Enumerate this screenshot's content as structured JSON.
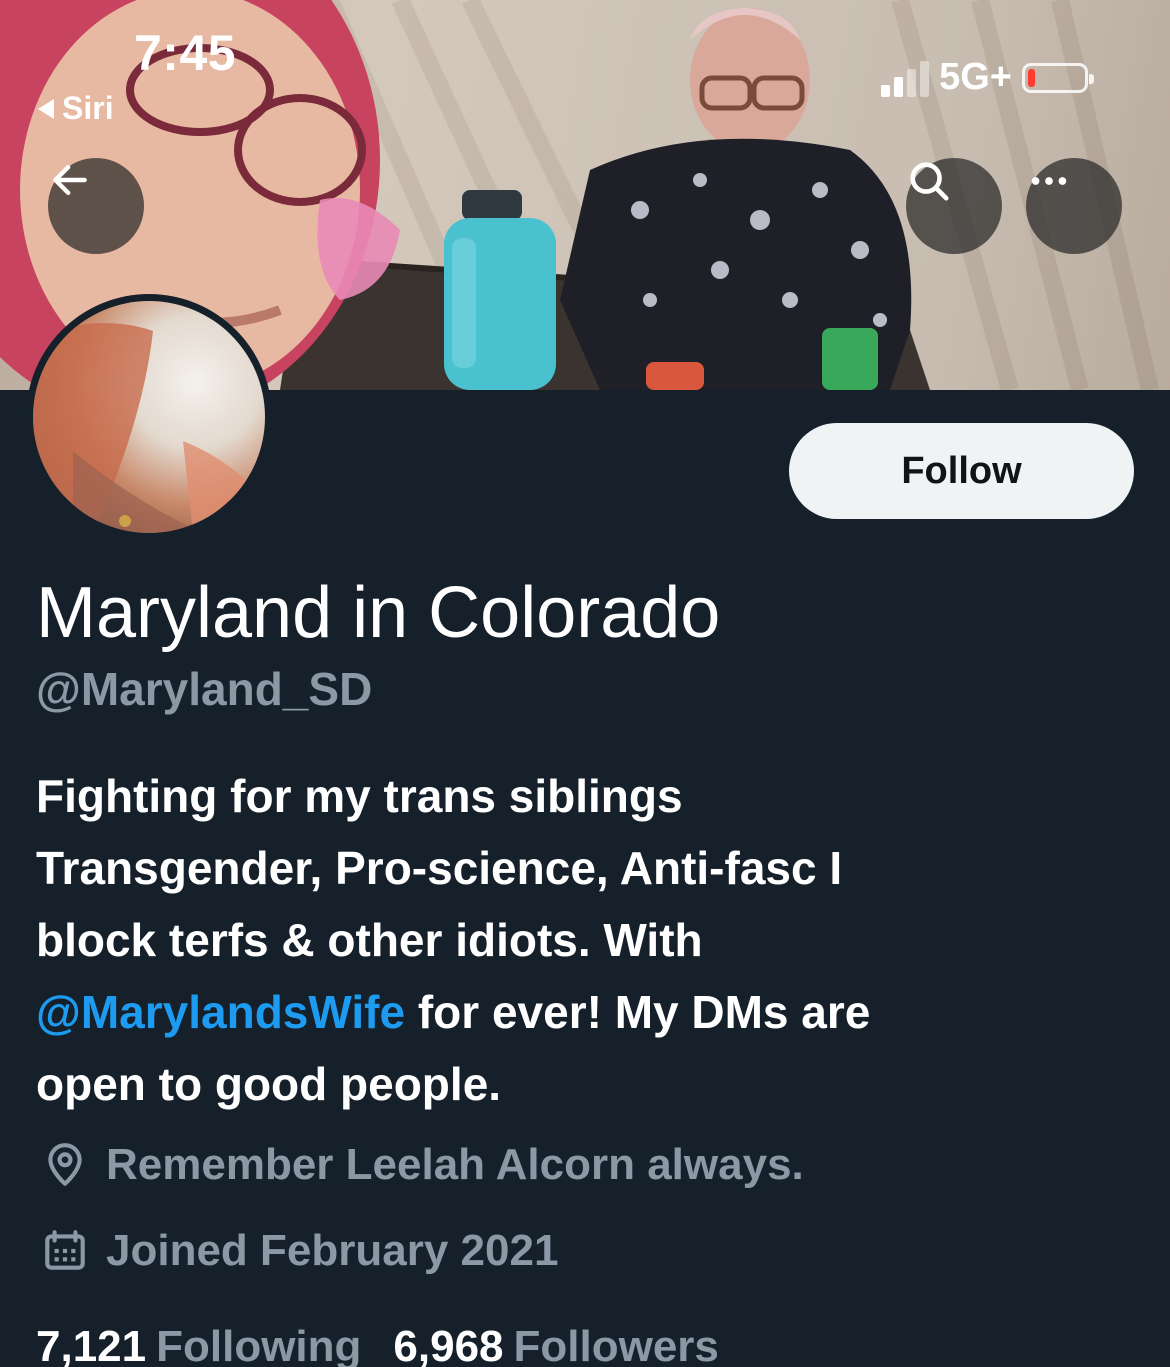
{
  "status_bar": {
    "time": "7:45",
    "back_app": "Siri",
    "network": "5G+",
    "battery_level_fraction": 0.08,
    "signal_bars_active": 2,
    "signal_bars_total": 4
  },
  "nav": {
    "back_icon": "arrow-left-icon",
    "search_icon": "search-icon",
    "more_icon": "more-horizontal-icon"
  },
  "profile": {
    "follow_label": "Follow",
    "display_name": "Maryland in Colorado",
    "handle": "@Maryland_SD",
    "bio": {
      "line1": "Fighting for my trans siblings",
      "line2": "Transgender, Pro-science, Anti-fasc I",
      "line3": "block terfs & other idiots. With",
      "mention": "@MarylandsWife",
      "line4_rest": " for ever! My DMs are",
      "line5": "open to good people."
    },
    "location": "Remember Leelah Alcorn always.",
    "joined": "Joined February 2021",
    "following_count": "7,121",
    "following_label": "Following",
    "followers_count": "6,968",
    "followers_label": "Followers"
  },
  "colors": {
    "background": "#15202b",
    "mention": "#1d9bf0",
    "secondary_text": "#8b98a5",
    "follow_button_bg": "#eff3f4",
    "battery_low": "#ff3b30"
  }
}
